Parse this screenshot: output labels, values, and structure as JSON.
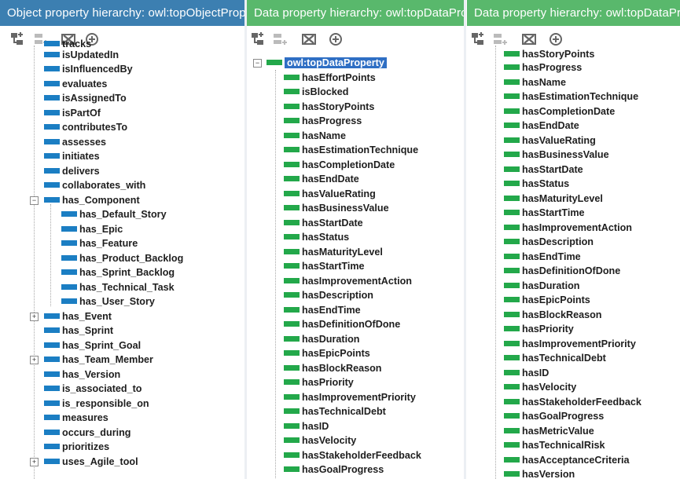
{
  "panels": {
    "object": {
      "title": "Object property hierarchy: owl:topObjectProperty"
    },
    "data_middle": {
      "title": "Data property hierarchy: owl:topDataProperty"
    },
    "data_right": {
      "title": "Data property hierarchy: owl:topDataProperty"
    }
  },
  "object_tree": {
    "partial_top": "tracks",
    "items": [
      {
        "label": "isUpdatedIn",
        "indent": 1,
        "expander": ""
      },
      {
        "label": "isInfluencedBy",
        "indent": 1,
        "expander": ""
      },
      {
        "label": "evaluates",
        "indent": 1,
        "expander": ""
      },
      {
        "label": "isAssignedTo",
        "indent": 1,
        "expander": ""
      },
      {
        "label": "isPartOf",
        "indent": 1,
        "expander": ""
      },
      {
        "label": "contributesTo",
        "indent": 1,
        "expander": ""
      },
      {
        "label": "assesses",
        "indent": 1,
        "expander": ""
      },
      {
        "label": "initiates",
        "indent": 1,
        "expander": ""
      },
      {
        "label": "delivers",
        "indent": 1,
        "expander": ""
      },
      {
        "label": "collaborates_with",
        "indent": 1,
        "expander": ""
      },
      {
        "label": "has_Component",
        "indent": 1,
        "expander": "−"
      },
      {
        "label": "has_Default_Story",
        "indent": 2,
        "expander": ""
      },
      {
        "label": "has_Epic",
        "indent": 2,
        "expander": ""
      },
      {
        "label": "has_Feature",
        "indent": 2,
        "expander": ""
      },
      {
        "label": "has_Product_Backlog",
        "indent": 2,
        "expander": ""
      },
      {
        "label": "has_Sprint_Backlog",
        "indent": 2,
        "expander": ""
      },
      {
        "label": "has_Technical_Task",
        "indent": 2,
        "expander": ""
      },
      {
        "label": "has_User_Story",
        "indent": 2,
        "expander": ""
      },
      {
        "label": "has_Event",
        "indent": 1,
        "expander": "+"
      },
      {
        "label": "has_Sprint",
        "indent": 1,
        "expander": ""
      },
      {
        "label": "has_Sprint_Goal",
        "indent": 1,
        "expander": ""
      },
      {
        "label": "has_Team_Member",
        "indent": 1,
        "expander": "+"
      },
      {
        "label": "has_Version",
        "indent": 1,
        "expander": ""
      },
      {
        "label": "is_associated_to",
        "indent": 1,
        "expander": ""
      },
      {
        "label": "is_responsible_on",
        "indent": 1,
        "expander": ""
      },
      {
        "label": "measures",
        "indent": 1,
        "expander": ""
      },
      {
        "label": "occurs_during",
        "indent": 1,
        "expander": ""
      },
      {
        "label": "prioritizes",
        "indent": 1,
        "expander": ""
      },
      {
        "label": "uses_Agile_tool",
        "indent": 1,
        "expander": "+"
      }
    ]
  },
  "data_tree_middle": {
    "root": {
      "label": "owl:topDataProperty",
      "expander": "−"
    },
    "items": [
      "hasEffortPoints",
      "isBlocked",
      "hasStoryPoints",
      "hasProgress",
      "hasName",
      "hasEstimationTechnique",
      "hasCompletionDate",
      "hasEndDate",
      "hasValueRating",
      "hasBusinessValue",
      "hasStartDate",
      "hasStatus",
      "hasMaturityLevel",
      "hasStartTime",
      "hasImprovementAction",
      "hasDescription",
      "hasEndTime",
      "hasDefinitionOfDone",
      "hasDuration",
      "hasEpicPoints",
      "hasBlockReason",
      "hasPriority",
      "hasImprovementPriority",
      "hasTechnicalDebt",
      "hasID",
      "hasVelocity",
      "hasStakeholderFeedback",
      "hasGoalProgress"
    ]
  },
  "data_tree_right": {
    "partial_top": "hasStoryPoints",
    "items": [
      "hasProgress",
      "hasName",
      "hasEstimationTechnique",
      "hasCompletionDate",
      "hasEndDate",
      "hasValueRating",
      "hasBusinessValue",
      "hasStartDate",
      "hasStatus",
      "hasMaturityLevel",
      "hasStartTime",
      "hasImprovementAction",
      "hasDescription",
      "hasEndTime",
      "hasDefinitionOfDone",
      "hasDuration",
      "hasEpicPoints",
      "hasBlockReason",
      "hasPriority",
      "hasImprovementPriority",
      "hasTechnicalDebt",
      "hasID",
      "hasVelocity",
      "hasStakeholderFeedback",
      "hasGoalProgress",
      "hasMetricValue",
      "hasTechnicalRisk",
      "hasAcceptanceCriteria",
      "hasVersion"
    ]
  },
  "toolbar_icons": [
    "add-sub-property-icon",
    "add-sibling-property-icon",
    "delete-property-icon",
    "annotation-icon"
  ],
  "colors": {
    "object_header": "#3c7fb1",
    "data_header": "#59b86c",
    "object_property_bar": "#1b7ec3",
    "data_property_bar": "#23a84a",
    "selection": "#2f6fc4"
  }
}
